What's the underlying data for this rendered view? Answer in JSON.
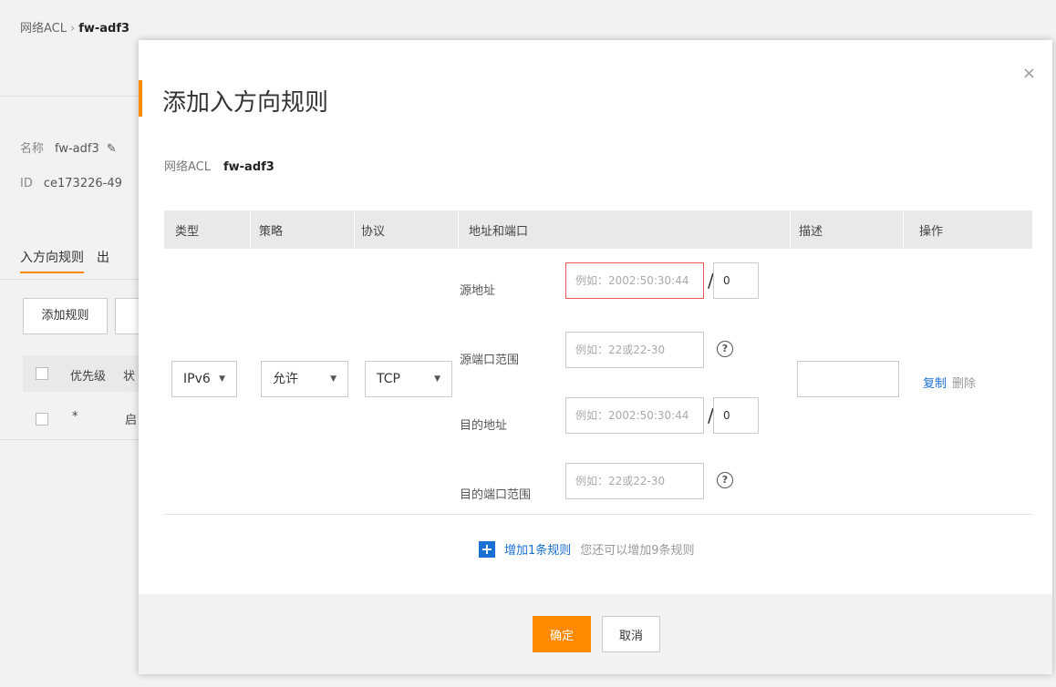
{
  "background": {
    "breadcrumb": {
      "parent": "网络ACL",
      "separator": "›",
      "current": "fw-adf3"
    },
    "name_label": "名称",
    "name_value": "fw-adf3",
    "id_label": "ID",
    "id_value": "ce173226-49",
    "tabs": [
      "入方向规则",
      "出"
    ],
    "add_rule_button": "添加规则",
    "table_headers": [
      "优先级",
      "状"
    ],
    "row": {
      "priority": "*",
      "status": "启"
    }
  },
  "modal": {
    "title": "添加入方向规则",
    "close_label": "×",
    "acl_label": "网络ACL",
    "acl_value": "fw-adf3",
    "headers": {
      "type": "类型",
      "policy": "策略",
      "protocol": "协议",
      "addr_port": "地址和端口",
      "desc": "描述",
      "op": "操作"
    },
    "rule": {
      "type": "IPv6",
      "policy": "允许",
      "protocol": "TCP",
      "src_addr_label": "源地址",
      "src_addr_placeholder": "例如：2002:50:30:44",
      "src_prefix": "0",
      "src_port_label": "源端口范围",
      "src_port_placeholder": "例如：22或22-30",
      "dst_addr_label": "目的地址",
      "dst_addr_placeholder": "例如：2002:50:30:44",
      "dst_prefix": "0",
      "dst_port_label": "目的端口范围",
      "dst_port_placeholder": "例如：22或22-30",
      "desc_value": "",
      "copy_label": "复制",
      "delete_label": "删除"
    },
    "add_more": {
      "plus": "+",
      "link": "增加1条规则",
      "hint": "您还可以增加9条规则"
    },
    "footer": {
      "ok": "确定",
      "cancel": "取消"
    }
  },
  "colors": {
    "accent": "#ff8a00",
    "link": "#1a6fd4",
    "error_border": "#e85a5a"
  },
  "icons": {
    "caret": "caret-down-icon",
    "help": "question-circle-icon",
    "plus": "plus-icon",
    "close": "close-icon",
    "edit": "pencil-icon"
  }
}
